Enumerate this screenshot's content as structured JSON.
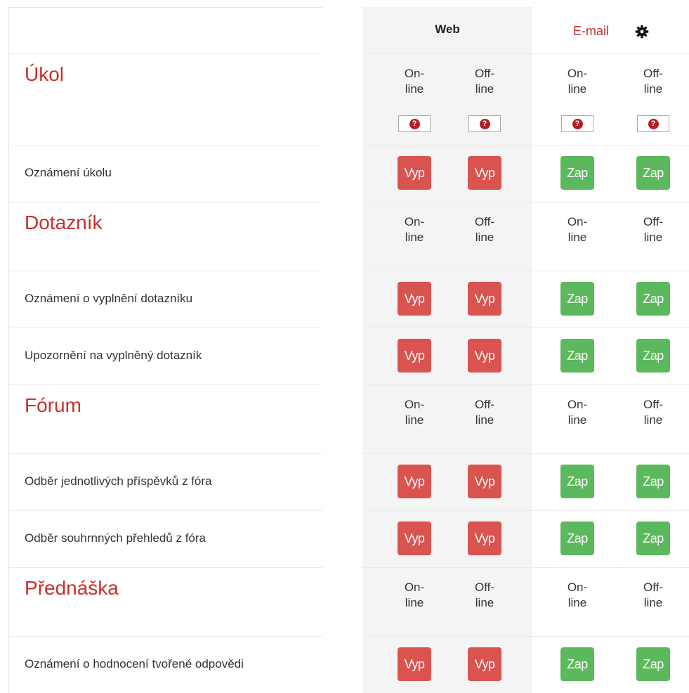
{
  "header": {
    "web_label": "Web",
    "email_label": "E-mail",
    "email_settings_icon": "gear-icon"
  },
  "state_labels": {
    "online": "On-\nline",
    "offline": "Off-\nline"
  },
  "help_icon": "question-circle-icon",
  "colors": {
    "accent": "#c9302c",
    "off": "#d9534f",
    "on": "#5cb85c",
    "web_col_bg": "#f4f4f4"
  },
  "sections": [
    {
      "title": "Úkol",
      "show_help": true,
      "rows": [
        {
          "label": "Oznámení úkolu",
          "web_online": "Vyp",
          "web_offline": "Vyp",
          "email_online": "Zap",
          "email_offline": "Zap"
        }
      ]
    },
    {
      "title": "Dotazník",
      "show_help": false,
      "rows": [
        {
          "label": "Oznámení o vyplnění dotazníku",
          "web_online": "Vyp",
          "web_offline": "Vyp",
          "email_online": "Zap",
          "email_offline": "Zap"
        },
        {
          "label": "Upozornění na vyplněný dotazník",
          "web_online": "Vyp",
          "web_offline": "Vyp",
          "email_online": "Zap",
          "email_offline": "Zap"
        }
      ]
    },
    {
      "title": "Fórum",
      "show_help": false,
      "rows": [
        {
          "label": "Odběr jednotlivých příspěvků z fóra",
          "web_online": "Vyp",
          "web_offline": "Vyp",
          "email_online": "Zap",
          "email_offline": "Zap"
        },
        {
          "label": "Odběr souhrnných přehledů z fóra",
          "web_online": "Vyp",
          "web_offline": "Vyp",
          "email_online": "Zap",
          "email_offline": "Zap"
        }
      ]
    },
    {
      "title": "Přednáška",
      "show_help": false,
      "rows": [
        {
          "label": "Oznámení o hodnocení tvořené odpovědi",
          "web_online": "Vyp",
          "web_offline": "Vyp",
          "email_online": "Zap",
          "email_offline": "Zap"
        }
      ]
    }
  ]
}
